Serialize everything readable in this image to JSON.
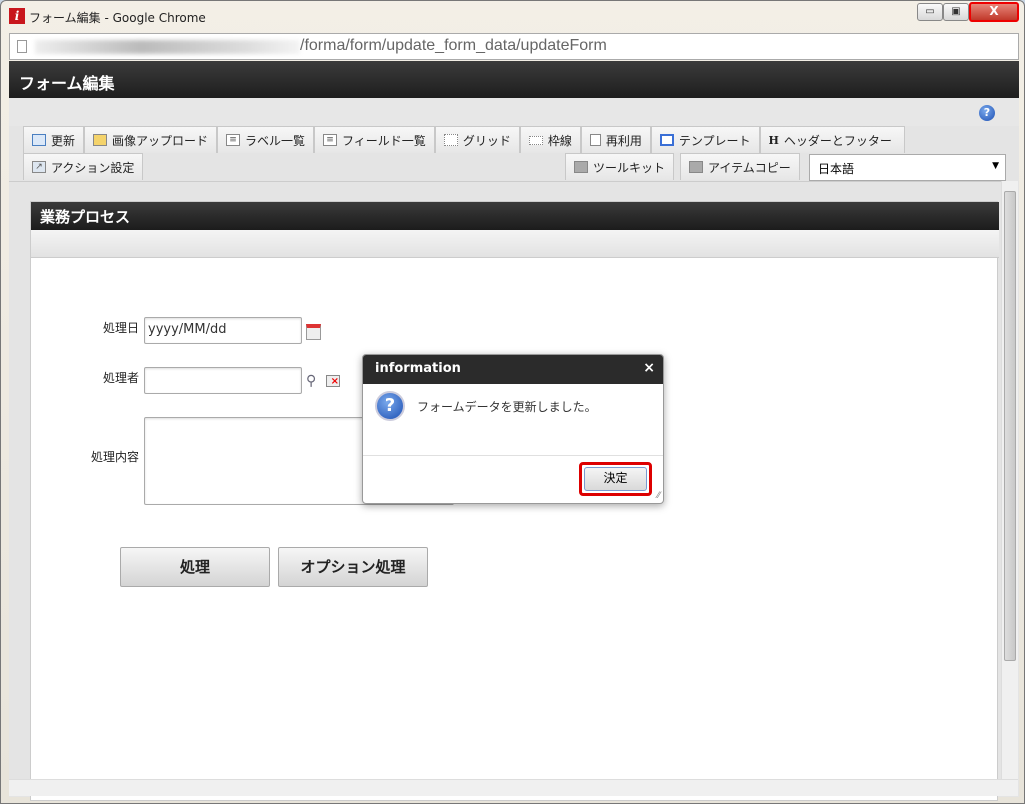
{
  "window": {
    "title": "フォーム編集 - Google Chrome",
    "app_icon": "i",
    "minimize": "▭",
    "maximize": "▣",
    "close": "X"
  },
  "address": {
    "url": "/forma/form/update_form_data/updateForm"
  },
  "app": {
    "title": "フォーム編集",
    "help": "?"
  },
  "tabs": [
    {
      "label": "更新",
      "icon": "update-icon"
    },
    {
      "label": "画像アップロード",
      "icon": "image-upload-icon"
    },
    {
      "label": "ラベル一覧",
      "icon": "label-list-icon"
    },
    {
      "label": "フィールド一覧",
      "icon": "field-list-icon"
    },
    {
      "label": "グリッド",
      "icon": "grid-icon"
    },
    {
      "label": "枠線",
      "icon": "border-icon"
    },
    {
      "label": "再利用",
      "icon": "reuse-icon"
    },
    {
      "label": "テンプレート",
      "icon": "template-icon"
    },
    {
      "label": "ヘッダーとフッター",
      "icon": "header-footer-icon"
    }
  ],
  "tabs_row2": {
    "action": "アクション設定",
    "toolkit": "ツールキット",
    "item_copy": "アイテムコピー",
    "language": "日本語"
  },
  "panel": {
    "title": "業務プロセス"
  },
  "form": {
    "date_label": "処理日",
    "date_value": "yyyy/MM/dd",
    "user_label": "処理者",
    "user_value": "",
    "content_label": "処理内容",
    "content_value": "",
    "process_button": "処理",
    "option_button": "オプション処理"
  },
  "dialog": {
    "title": "information",
    "close": "×",
    "message": "フォームデータを更新しました。",
    "ok": "決定",
    "icon": "?"
  }
}
